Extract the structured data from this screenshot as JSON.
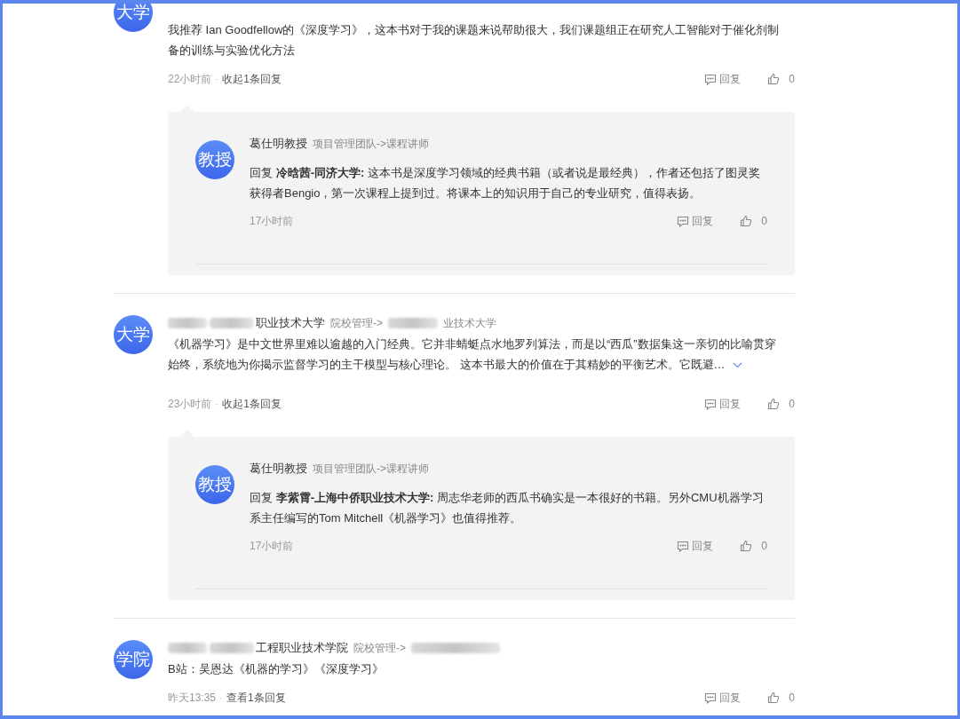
{
  "comments": [
    {
      "avatar": "大学",
      "cut_top": true,
      "text": "我推荐 Ian Goodfellow的《深度学习》，这本书对于我的课题来说帮助很大，我们课题组正在研究人工智能对于催化剂制备的训练与实验优化方法",
      "expandable": false,
      "time": "22小时前",
      "separator": "·",
      "toggle": "收起1条回复",
      "reply_action": "回复",
      "likes": "0",
      "replies": [
        {
          "avatar": "教授",
          "author": "葛仕明教授",
          "role": "项目管理团队->课程讲师",
          "text": "回复 **冷晗茜-同济大学:** 这本书是深度学习领域的经典书籍（或者说是最经典），作者还包括了图灵奖获得者Bengio，第一次课程上提到过。将课本上的知识用于自己的专业研究，值得表扬。",
          "time": "17小时前",
          "reply_action": "回复",
          "likes": "0"
        }
      ]
    },
    {
      "avatar": "大学",
      "cut_top": false,
      "redacted": true,
      "author": "职业技术大学",
      "role_prefix": "院校管理->",
      "role_suffix": "业技术大学",
      "text": "《机器学习》是中文世界里难以逾越的入门经典。它并非蜻蜓点水地罗列算法，而是以“西瓜”数据集这一亲切的比喻贯穿始终，系统地为你揭示监督学习的主干模型与核心理论。 这本书最大的价值在于其精妙的平衡艺术。它既避…",
      "expandable": true,
      "time": "23小时前",
      "separator": "·",
      "toggle": "收起1条回复",
      "reply_action": "回复",
      "likes": "0",
      "replies": [
        {
          "avatar": "教授",
          "author": "葛仕明教授",
          "role": "项目管理团队->课程讲师",
          "text": "回复 **李紫霄-上海中侨职业技术大学:** 周志华老师的西瓜书确实是一本很好的书籍。另外CMU机器学习系主任编写的Tom Mitchell《机器学习》也值得推荐。",
          "time": "17小时前",
          "reply_action": "回复",
          "likes": "0"
        }
      ]
    },
    {
      "avatar": "学院",
      "cut_top": false,
      "redacted": true,
      "author": "工程职业技术学院",
      "role_prefix": "院校管理->",
      "text": "B站：吴恩达《机器的学习》《深度学习》",
      "expandable": false,
      "time": "昨天13:35",
      "separator": "·",
      "toggle": "查看1条回复",
      "reply_action": "回复",
      "likes": "0"
    }
  ]
}
